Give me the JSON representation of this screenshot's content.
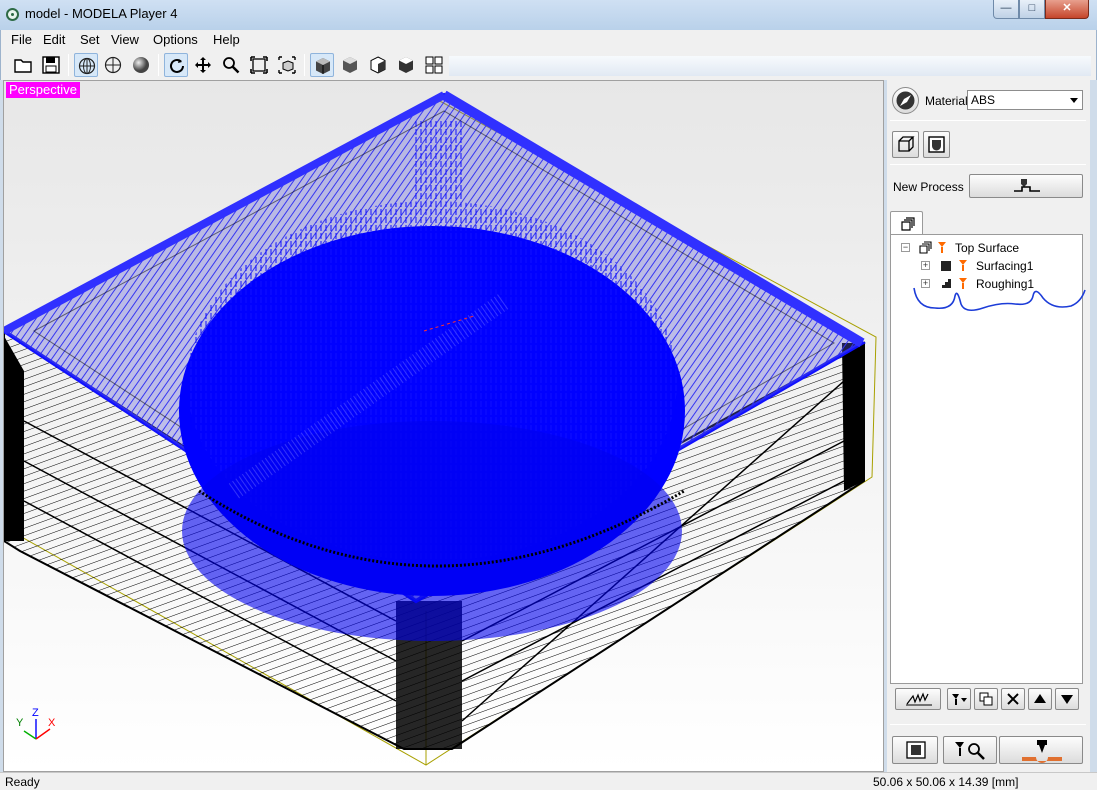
{
  "window": {
    "title": "model - MODELA Player 4",
    "min": "—",
    "max": "□",
    "close": "✕"
  },
  "menu": [
    "File",
    "Edit",
    "Set",
    "View",
    "Options",
    "Help"
  ],
  "viewport": {
    "view_label": "Perspective",
    "axis_y": "Y",
    "axis_z": "Z",
    "axis_x": "X"
  },
  "panel": {
    "material_label": "Material",
    "material_value": "ABS",
    "new_process_label": "New Process"
  },
  "tree": {
    "root": "Top Surface",
    "children": [
      "Surfacing1",
      "Roughing1"
    ]
  },
  "status": {
    "left": "Ready",
    "dimensions": "50.06 x 50.06 x 14.39 [mm]"
  },
  "colors": {
    "toolpath": "#1010ff",
    "mesh": "#000000",
    "label_bg": "#ff00ff",
    "annotation": "#1c3cd8"
  }
}
